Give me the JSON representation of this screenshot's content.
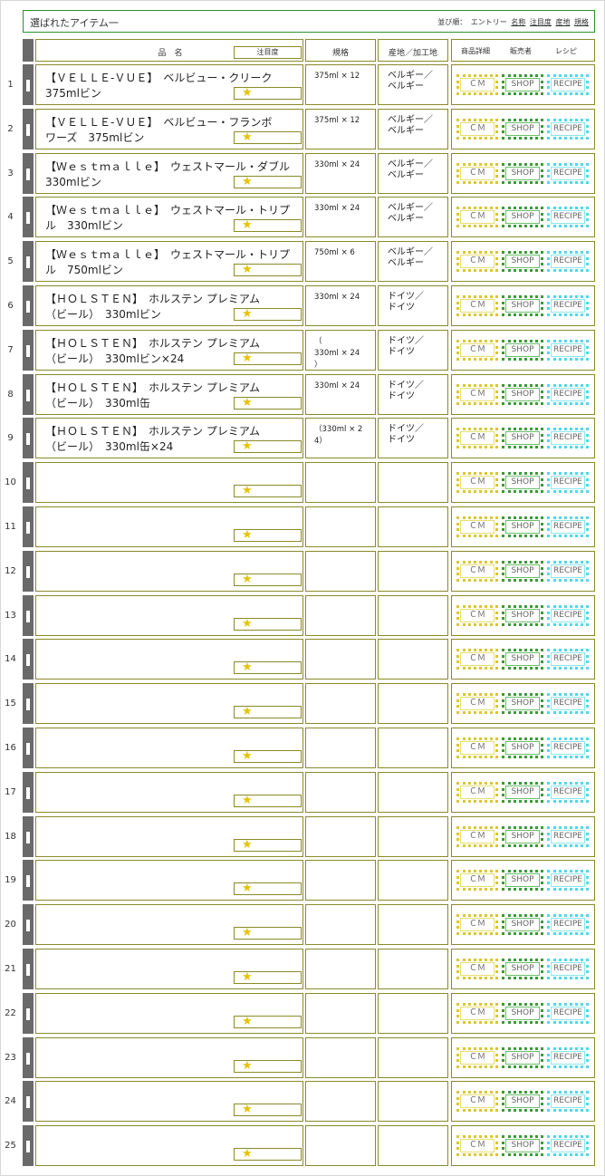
{
  "header": {
    "title": "選ばれたアイテム一",
    "sort_label": "並び順：",
    "sort_options": [
      "エントリー",
      "名称",
      "注目度",
      "産地",
      "規格"
    ]
  },
  "columns": {
    "name": "品　名",
    "attention": "注目度",
    "spec": "規格",
    "origin": "産地／加工地",
    "detail": "商品詳細",
    "seller": "販売者",
    "recipe": "レシピ"
  },
  "buttons": {
    "cm": "ＣＭ",
    "shop": "SHOP",
    "recipe": "RECIPE"
  },
  "attention_icon": "star-icon",
  "rows": [
    {
      "num": "1",
      "name": "【ＶＥＬＬＥ-ＶＵＥ】　ベルビュー・クリーク\n375mlビン",
      "spec": "375ml × 12",
      "origin": "ベルギー／\nベルギー"
    },
    {
      "num": "2",
      "name": "【ＶＥＬＬＥ-ＶＵＥ】　ベルビュー・フランボ\nワーズ　375mlビン",
      "spec": "375ml × 12",
      "origin": "ベルギー／\nベルギー"
    },
    {
      "num": "3",
      "name": "【Ｗｅｓｔｍａｌｌｅ】　ウェストマール・ダブル\n330mlビン",
      "spec": "330ml × 24",
      "origin": "ベルギー／\nベルギー"
    },
    {
      "num": "4",
      "name": "【Ｗｅｓｔｍａｌｌｅ】　ウェストマール・トリプ\nル　330mlビン",
      "spec": "330ml × 24",
      "origin": "ベルギー／\nベルギー"
    },
    {
      "num": "5",
      "name": "【Ｗｅｓｔｍａｌｌｅ】　ウェストマール・トリプ\nル　750mlビン",
      "spec": "750ml × 6",
      "origin": "ベルギー／\nベルギー"
    },
    {
      "num": "6",
      "name": "【ＨＯＬＳＴＥＮ】　ホルステン プレミアム\n（ビール）　330mlビン",
      "spec": "330ml × 24",
      "origin": "ドイツ／\nドイツ"
    },
    {
      "num": "7",
      "name": "【ＨＯＬＳＴＥＮ】　ホルステン プレミアム\n（ビール）　330mlビン×24",
      "spec": "（\n330ml × 24\n）",
      "origin": "ドイツ／\nドイツ"
    },
    {
      "num": "8",
      "name": "【ＨＯＬＳＴＥＮ】　ホルステン プレミアム\n（ビール）　330ml缶",
      "spec": "330ml × 24",
      "origin": "ドイツ／\nドイツ"
    },
    {
      "num": "9",
      "name": "【ＨＯＬＳＴＥＮ】　ホルステン プレミアム\n（ビール）　330ml缶×24",
      "spec": "（330ml × 2\n4）",
      "origin": "ドイツ／\nドイツ"
    },
    {
      "num": "10",
      "name": "",
      "spec": "",
      "origin": ""
    },
    {
      "num": "11",
      "name": "",
      "spec": "",
      "origin": ""
    },
    {
      "num": "12",
      "name": "",
      "spec": "",
      "origin": ""
    },
    {
      "num": "13",
      "name": "",
      "spec": "",
      "origin": ""
    },
    {
      "num": "14",
      "name": "",
      "spec": "",
      "origin": ""
    },
    {
      "num": "15",
      "name": "",
      "spec": "",
      "origin": ""
    },
    {
      "num": "16",
      "name": "",
      "spec": "",
      "origin": ""
    },
    {
      "num": "17",
      "name": "",
      "spec": "",
      "origin": ""
    },
    {
      "num": "18",
      "name": "",
      "spec": "",
      "origin": ""
    },
    {
      "num": "19",
      "name": "",
      "spec": "",
      "origin": ""
    },
    {
      "num": "20",
      "name": "",
      "spec": "",
      "origin": ""
    },
    {
      "num": "21",
      "name": "",
      "spec": "",
      "origin": ""
    },
    {
      "num": "22",
      "name": "",
      "spec": "",
      "origin": ""
    },
    {
      "num": "23",
      "name": "",
      "spec": "",
      "origin": ""
    },
    {
      "num": "24",
      "name": "",
      "spec": "",
      "origin": ""
    },
    {
      "num": "25",
      "name": "",
      "spec": "",
      "origin": ""
    }
  ]
}
